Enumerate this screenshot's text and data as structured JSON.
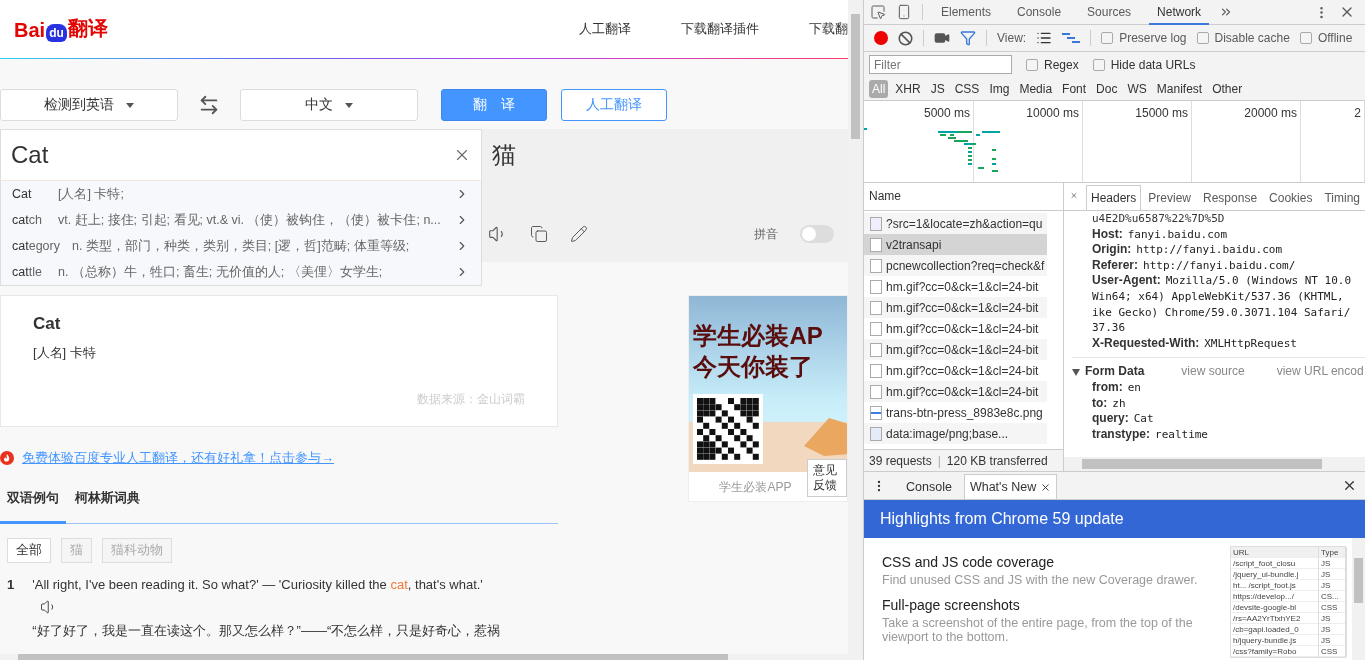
{
  "page": {
    "logo": {
      "brand": "Bai",
      "paw": "du",
      "product": "翻译"
    },
    "nav": [
      "人工翻译",
      "下载翻译插件",
      "下载翻"
    ],
    "source_lang": "检测到英语",
    "target_lang": "中文",
    "translate_button": "翻　译",
    "human_button": "人工翻译",
    "input": {
      "value": "Cat"
    },
    "suggestions": [
      {
        "match": "Cat",
        "meaning": "[人名] 卡特;"
      },
      {
        "match": "cat",
        "rest": "ch",
        "meaning": "vt. 赶上; 接住; 引起; 看见; vt.& vi. （使）被钩住，（使）被卡住; n..."
      },
      {
        "match": "cat",
        "rest": "egory",
        "meaning": "n. 类型，部门，种类，类别，类目; [逻，哲]范畴; 体重等级;"
      },
      {
        "match": "cat",
        "rest": "tle",
        "meaning": "n. （总称）牛，牲口; 畜生; 无价值的人; 〈美俚〉女学生;"
      }
    ],
    "output": {
      "text": "猫",
      "pinyin_label": "拼音",
      "pinyin_on": false
    },
    "dict_card": {
      "word": "Cat",
      "meaning": "[人名] 卡特",
      "source": "数据来源：金山词霸"
    },
    "ad": {
      "headline": [
        "学生必装AP",
        "今天你装了"
      ],
      "caption": "学生必装APP"
    },
    "feedback": "意见反馈",
    "promo_link": "免费体验百度专业人工翻译，还有好礼拿！点击参与→",
    "tabs": [
      {
        "label": "双语例句",
        "selected": true
      },
      {
        "label": "柯林斯词典",
        "selected": false
      }
    ],
    "filters": [
      {
        "label": "全部",
        "selected": true
      },
      {
        "label": "猫",
        "selected": false
      },
      {
        "label": "猫科动物",
        "selected": false
      }
    ],
    "examples": [
      {
        "number": "1",
        "en_parts": [
          {
            "text": "'All right, I've been reading it. So what?' — 'Curiosity killed the ",
            "highlight": false
          },
          {
            "text": "cat",
            "highlight": true
          },
          {
            "text": ", that's what.'",
            "highlight": false
          }
        ],
        "zh": "“好了好了，我是一直在读这个。那又怎么样？”——“不怎么样，只是好奇心，惹祸"
      }
    ]
  },
  "devtools": {
    "tabs": [
      {
        "label": "Elements",
        "selected": false
      },
      {
        "label": "Console",
        "selected": false
      },
      {
        "label": "Sources",
        "selected": false
      },
      {
        "label": "Network",
        "selected": true
      }
    ],
    "recording": true,
    "filter_active": true,
    "view_label": "View:",
    "options": [
      {
        "label": "Preserve log",
        "checked": false
      },
      {
        "label": "Disable cache",
        "checked": false
      },
      {
        "label": "Offline",
        "checked": false
      }
    ],
    "filter": {
      "placeholder": "Filter"
    },
    "filter_options": [
      {
        "label": "Regex",
        "checked": false
      },
      {
        "label": "Hide data URLs",
        "checked": false
      }
    ],
    "types": [
      {
        "label": "All",
        "selected": true
      },
      {
        "label": "XHR",
        "selected": false
      },
      {
        "label": "JS",
        "selected": false
      },
      {
        "label": "CSS",
        "selected": false
      },
      {
        "label": "Img",
        "selected": false
      },
      {
        "label": "Media",
        "selected": false
      },
      {
        "label": "Font",
        "selected": false
      },
      {
        "label": "Doc",
        "selected": false
      },
      {
        "label": "WS",
        "selected": false
      },
      {
        "label": "Manifest",
        "selected": false
      },
      {
        "label": "Other",
        "selected": false
      }
    ],
    "timeline_ticks": [
      "5000 ms",
      "10000 ms",
      "15000 ms",
      "20000 ms",
      "2"
    ],
    "requests": {
      "header": "Name",
      "rows": [
        {
          "name": "?src=1&locate=zh&action=qu",
          "kind": "doc",
          "selected": false
        },
        {
          "name": "v2transapi",
          "kind": "blank",
          "selected": true
        },
        {
          "name": "pcnewcollection?req=check&f",
          "kind": "blank",
          "selected": false
        },
        {
          "name": "hm.gif?cc=0&ck=1&cl=24-bit",
          "kind": "blank",
          "selected": false
        },
        {
          "name": "hm.gif?cc=0&ck=1&cl=24-bit",
          "kind": "blank",
          "selected": false
        },
        {
          "name": "hm.gif?cc=0&ck=1&cl=24-bit",
          "kind": "blank",
          "selected": false
        },
        {
          "name": "hm.gif?cc=0&ck=1&cl=24-bit",
          "kind": "blank",
          "selected": false
        },
        {
          "name": "hm.gif?cc=0&ck=1&cl=24-bit",
          "kind": "blank",
          "selected": false
        },
        {
          "name": "hm.gif?cc=0&ck=1&cl=24-bit",
          "kind": "blank",
          "selected": false
        },
        {
          "name": "trans-btn-press_8983e8c.png",
          "selected": false
        },
        {
          "name": "data:image/png;base...",
          "kind": "data",
          "selected": false
        }
      ],
      "summary_count": "39 requests",
      "summary_separator": "|",
      "summary_size": "120 KB transferred"
    },
    "detail": {
      "tabs": [
        {
          "label": "Headers",
          "selected": true
        },
        {
          "label": "Preview",
          "selected": false
        },
        {
          "label": "Response",
          "selected": false
        },
        {
          "label": "Cookies",
          "selected": false
        },
        {
          "label": "Timing",
          "selected": false
        }
      ],
      "cut_line": "u4E2D%u6587%22%7D%5D",
      "headers": [
        {
          "key": "Host:",
          "value": "fanyi.baidu.com"
        },
        {
          "key": "Origin:",
          "value": "http://fanyi.baidu.com"
        },
        {
          "key": "Referer:",
          "value": "http://fanyi.baidu.com/"
        },
        {
          "key": "User-Agent:",
          "value": "Mozilla/5.0 (Windows NT 10.0",
          "continuation": [
            "Win64; x64) AppleWebKit/537.36 (KHTML,",
            "ike Gecko) Chrome/59.0.3071.104 Safari/",
            "37.36"
          ]
        },
        {
          "key": "X-Requested-With:",
          "value": "XMLHttpRequest"
        }
      ],
      "form_data": {
        "title": "Form Data",
        "expanded": true,
        "links": [
          "view source",
          "view URL encod"
        ],
        "fields": [
          {
            "key": "from:",
            "value": "en"
          },
          {
            "key": "to:",
            "value": "zh"
          },
          {
            "key": "query:",
            "value": "Cat"
          },
          {
            "key": "transtype:",
            "value": "realtime"
          }
        ]
      }
    },
    "drawer": {
      "tabs": [
        {
          "label": "Console",
          "selected": false,
          "closable": false
        },
        {
          "label": "What's New",
          "selected": true,
          "closable": true
        }
      ],
      "banner": "Highlights from Chrome 59 update",
      "items": [
        {
          "title": "CSS and JS code coverage",
          "description": "Find unused CSS and JS with the new Coverage drawer."
        },
        {
          "title": "Full-page screenshots",
          "description": "Take a screenshot of the entire page, from the top of the viewport to the bottom."
        }
      ],
      "preview_table": {
        "columns": [
          "URL",
          "Type"
        ],
        "rows": [
          [
            "/script_foot_closu",
            "JS"
          ],
          [
            "/jquery_ui-bundle.j",
            "JS"
          ],
          [
            "ht... /script_foot.js",
            "JS"
          ],
          [
            "https://develop.../",
            "CS..."
          ],
          [
            "/devsite-google-bl",
            "CSS"
          ],
          [
            "/rs=AA2YrTtxhYE2",
            "JS"
          ],
          [
            "/cb=gapi.loaded_0",
            "JS"
          ],
          [
            "h/jquery-bundle.js",
            "JS"
          ],
          [
            "/css?family=Robo",
            "CSS"
          ]
        ]
      }
    }
  }
}
